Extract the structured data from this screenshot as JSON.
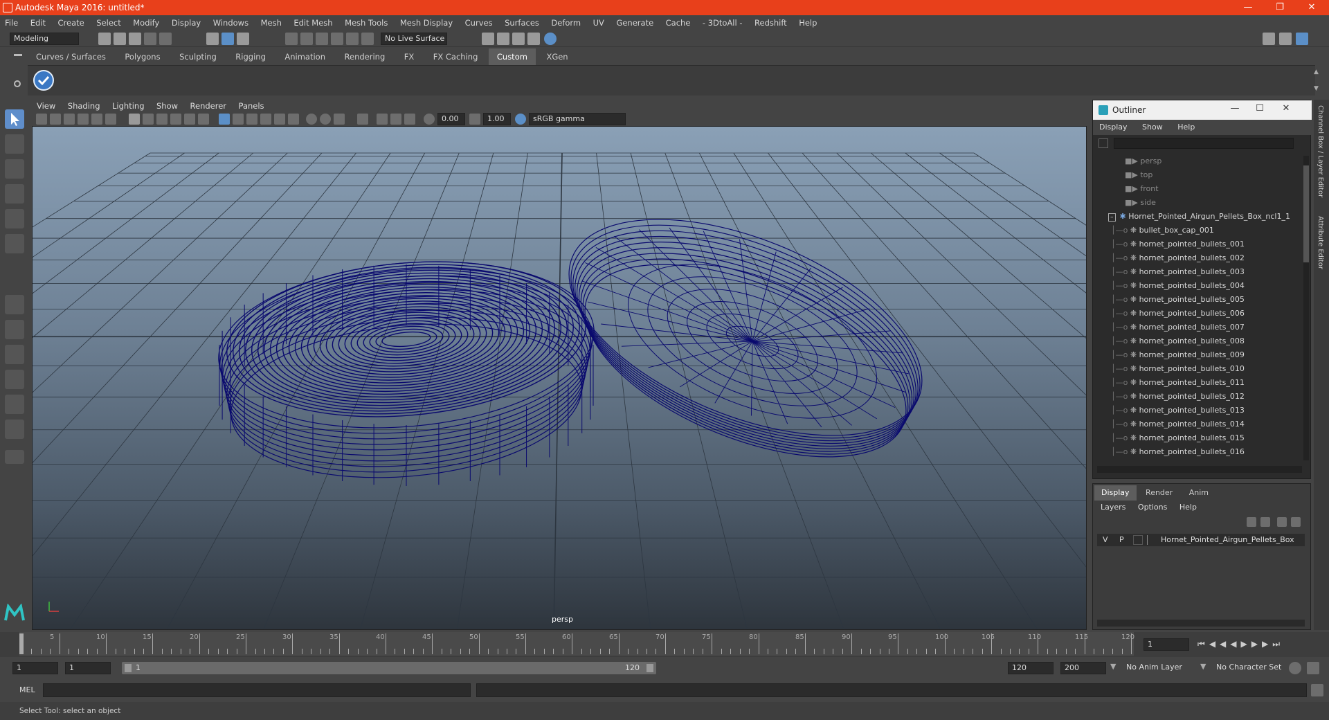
{
  "window": {
    "title": "Autodesk Maya 2016: untitled*"
  },
  "menubar": [
    "File",
    "Edit",
    "Create",
    "Select",
    "Modify",
    "Display",
    "Windows",
    "Mesh",
    "Edit Mesh",
    "Mesh Tools",
    "Mesh Display",
    "Curves",
    "Surfaces",
    "Deform",
    "UV",
    "Generate",
    "Cache",
    "- 3DtoAll -",
    "Redshift",
    "Help"
  ],
  "status": {
    "mode": "Modeling",
    "live_surface": "No Live Surface"
  },
  "shelf_tabs": [
    "Curves / Surfaces",
    "Polygons",
    "Sculpting",
    "Rigging",
    "Animation",
    "Rendering",
    "FX",
    "FX Caching",
    "Custom",
    "XGen"
  ],
  "shelf_active": "Custom",
  "viewport": {
    "menu": [
      "View",
      "Shading",
      "Lighting",
      "Show",
      "Renderer",
      "Panels"
    ],
    "exposure": "0.00",
    "gamma": "1.00",
    "color_space": "sRGB gamma",
    "camera_label": "persp",
    "wire_color": "#0a0a6e"
  },
  "outliner": {
    "title": "Outliner",
    "menu": [
      "Display",
      "Show",
      "Help"
    ],
    "cameras": [
      "persp",
      "top",
      "front",
      "side"
    ],
    "root": "Hornet_Pointed_Airgun_Pellets_Box_ncl1_1",
    "children": [
      "bullet_box_cap_001",
      "hornet_pointed_bullets_001",
      "hornet_pointed_bullets_002",
      "hornet_pointed_bullets_003",
      "hornet_pointed_bullets_004",
      "hornet_pointed_bullets_005",
      "hornet_pointed_bullets_006",
      "hornet_pointed_bullets_007",
      "hornet_pointed_bullets_008",
      "hornet_pointed_bullets_009",
      "hornet_pointed_bullets_010",
      "hornet_pointed_bullets_011",
      "hornet_pointed_bullets_012",
      "hornet_pointed_bullets_013",
      "hornet_pointed_bullets_014",
      "hornet_pointed_bullets_015",
      "hornet_pointed_bullets_016"
    ]
  },
  "layers": {
    "tabs": [
      "Display",
      "Render",
      "Anim"
    ],
    "menu": [
      "Layers",
      "Options",
      "Help"
    ],
    "row": {
      "v": "V",
      "p": "P",
      "name": "Hornet_Pointed_Airgun_Pellets_Box"
    }
  },
  "side_tabs": [
    "Channel Box / Layer Editor",
    "Attribute Editor"
  ],
  "timeslider": {
    "ticks": [
      5,
      10,
      15,
      20,
      25,
      30,
      35,
      40,
      45,
      50,
      55,
      60,
      65,
      70,
      75,
      80,
      85,
      90,
      95,
      100,
      105,
      110,
      115,
      120
    ],
    "current_frame": "1",
    "first_tick": "1"
  },
  "range": {
    "start": "1",
    "playback_start": "1",
    "range_start_label": "1",
    "range_end_label": "120",
    "end": "120",
    "max": "200",
    "anim_layer": "No Anim Layer",
    "char_set": "No Character Set"
  },
  "cmdline": {
    "label": "MEL"
  },
  "helpline": {
    "text": "Select Tool: select an object"
  }
}
